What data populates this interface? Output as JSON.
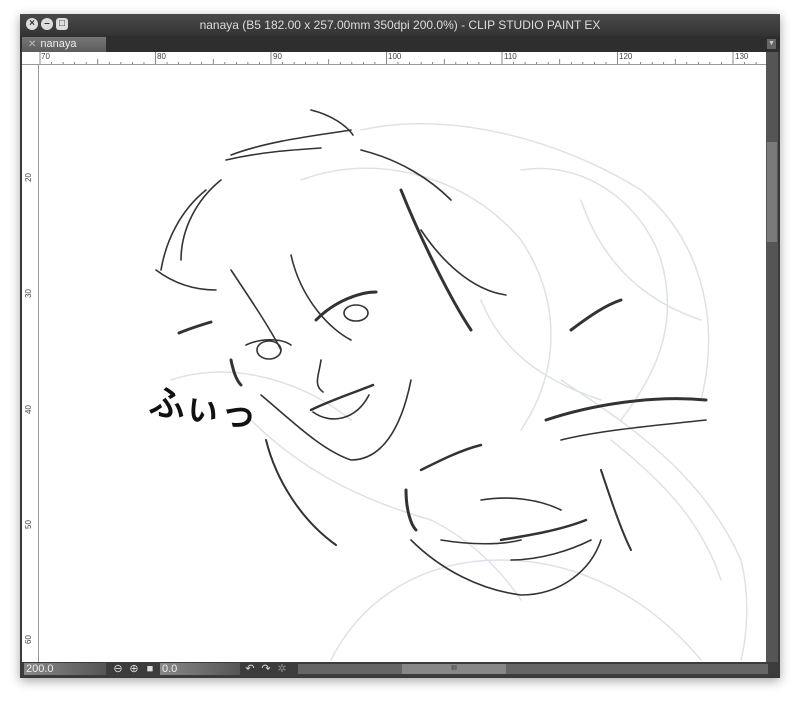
{
  "window": {
    "title": "nanaya (B5 182.00 x 257.00mm 350dpi 200.0%)  - CLIP STUDIO PAINT EX"
  },
  "tabs": [
    {
      "label": "nanaya",
      "icon": "close-icon"
    }
  ],
  "ruler": {
    "horizontal": [
      "70",
      "80",
      "90",
      "100",
      "110",
      "120",
      "130"
    ],
    "vertical": [
      "20",
      "30",
      "40",
      "50",
      "60"
    ]
  },
  "canvas": {
    "annotation_text": "ふぃっ"
  },
  "statusbar": {
    "zoom": "200.0",
    "rotation": "0.0",
    "icons": [
      "zoom-out-icon",
      "zoom-in-icon",
      "fit-icon",
      "rotate-left-icon",
      "rotate-right-icon",
      "reset-rotation-icon"
    ]
  }
}
